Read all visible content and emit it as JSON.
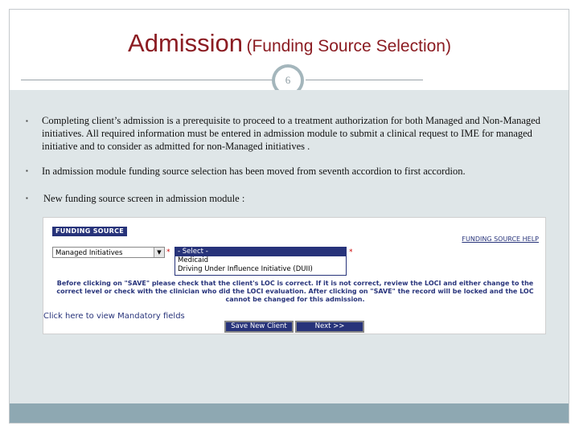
{
  "slide": {
    "title_main": "Admission",
    "title_sub": "(Funding Source Selection)",
    "page_number": "6",
    "bullets": [
      "Completing client’s admission is a prerequisite to proceed to a treatment authorization for both Managed and Non-Managed initiatives. All required information must be entered in admission module to submit a clinical request to IME for managed initiative and to consider as admitted for non-Managed initiatives .",
      "In admission module funding source selection has been moved from seventh accordion to first accordion.",
      "New funding source screen in admission module :"
    ]
  },
  "screenshot": {
    "section_label": "FUNDING SOURCE",
    "help_link": "FUNDING SOURCE HELP",
    "selected_value": "Managed Initiatives",
    "required_marker": "*",
    "dropdown_options": [
      "- Select -",
      "Medicaid",
      "Driving Under Influence Initiative (DUII)"
    ],
    "warning_text": "Before clicking on \"SAVE\" please check that the client's LOC is correct. If it is not correct, review the LOCI and either change to the correct level or check with the clinician who did the LOCI evaluation. After clicking on \"SAVE\" the record will be locked and the LOC cannot be changed for this admission.",
    "mandatory_link": "Click here to view Mandatory fields",
    "save_button": "Save New Client",
    "next_button": "Next >>"
  },
  "colors": {
    "title": "#8b1c22",
    "content_bg": "#dfe6e8",
    "bottom_bar": "#8ea8b2",
    "accent_navy": "#27337a"
  }
}
